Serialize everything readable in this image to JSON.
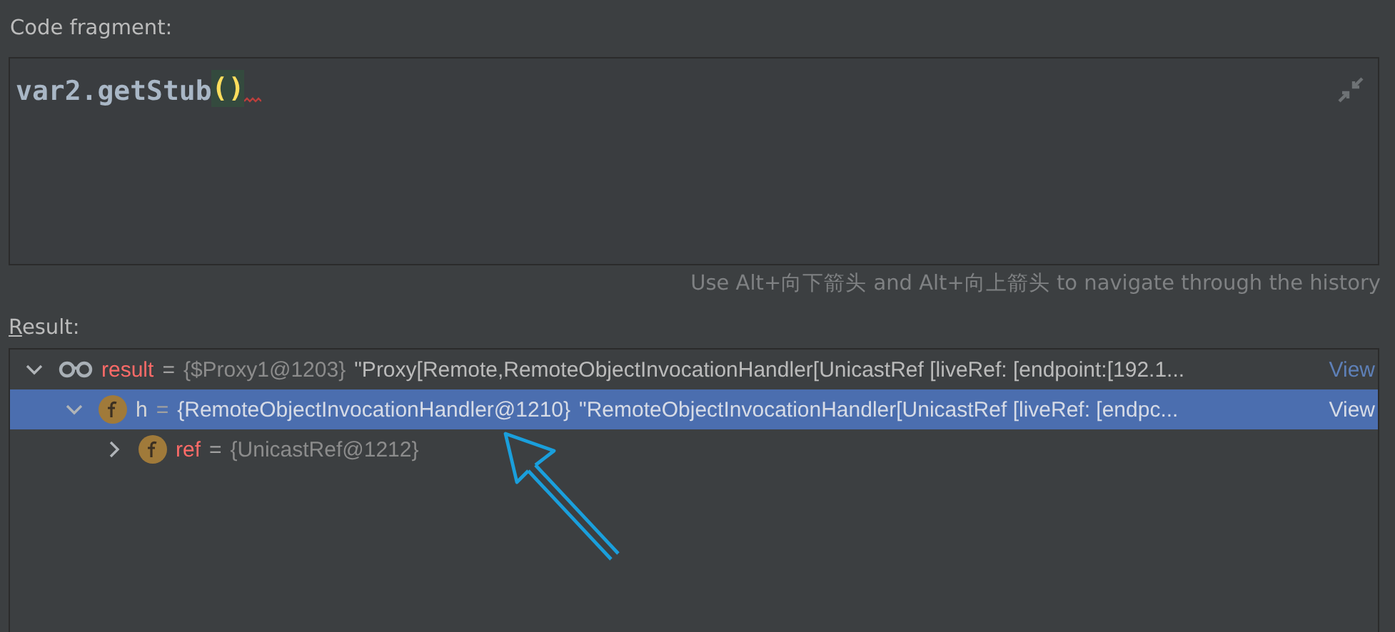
{
  "code_fragment": {
    "label": "Code fragment:",
    "code": "var2.getStub",
    "call_parens": "()",
    "matched_parens_highlight": true,
    "error_squiggle": true
  },
  "hint": "Use Alt+向下箭头 and Alt+向上箭头 to navigate through the history",
  "result": {
    "label": "Result:",
    "mnemonic_underlined": true,
    "tree": [
      {
        "kind": "watch",
        "name": "result",
        "separator": "=",
        "value": "{$Proxy1@1203}",
        "preview": "\"Proxy[Remote,RemoteObjectInvocationHandler[UnicastRef [liveRef: [endpoint:[192.1...",
        "link": "View",
        "expanded": true,
        "selected": false,
        "children": [
          {
            "kind": "field",
            "name": "h",
            "separator": "=",
            "value": "{RemoteObjectInvocationHandler@1210}",
            "preview": "\"RemoteObjectInvocationHandler[UnicastRef [liveRef: [endpc...",
            "link": "View",
            "expanded": true,
            "selected": true,
            "children": [
              {
                "kind": "field",
                "name": "ref",
                "separator": "=",
                "value": "{UnicastRef@1212}",
                "expanded": false,
                "selected": false
              }
            ]
          }
        ]
      }
    ]
  },
  "annotation": {
    "kind": "arrow"
  }
}
